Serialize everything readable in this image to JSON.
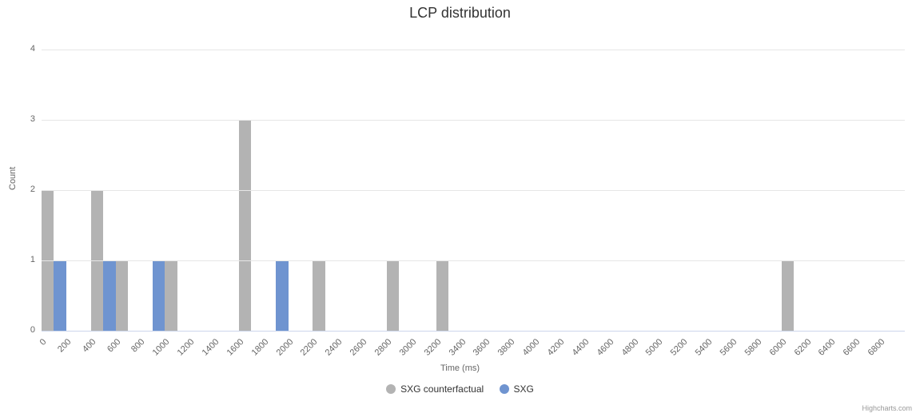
{
  "chart_data": {
    "type": "bar",
    "title": "LCP distribution",
    "xlabel": "Time (ms)",
    "ylabel": "Count",
    "ylim": [
      0,
      4
    ],
    "categories": [
      0,
      200,
      400,
      600,
      800,
      1000,
      1200,
      1400,
      1600,
      1800,
      2000,
      2200,
      2400,
      2600,
      2800,
      3000,
      3200,
      3400,
      3600,
      3800,
      4000,
      4200,
      4400,
      4600,
      4800,
      5000,
      5200,
      5400,
      5600,
      5800,
      6000,
      6200,
      6400,
      6600,
      6800
    ],
    "series": [
      {
        "name": "SXG counterfactual",
        "color": "#b3b3b3",
        "values": [
          2,
          0,
          2,
          1,
          0,
          1,
          0,
          0,
          3,
          0,
          0,
          1,
          0,
          0,
          1,
          0,
          1,
          0,
          0,
          0,
          0,
          0,
          0,
          0,
          0,
          0,
          0,
          0,
          0,
          0,
          1,
          0,
          0,
          0,
          0
        ]
      },
      {
        "name": "SXG",
        "color": "#6f94d0",
        "values": [
          1,
          0,
          1,
          0,
          1,
          0,
          0,
          0,
          0,
          1,
          0,
          0,
          0,
          0,
          0,
          0,
          0,
          0,
          0,
          0,
          0,
          0,
          0,
          0,
          0,
          0,
          0,
          0,
          0,
          0,
          0,
          0,
          0,
          0,
          0
        ]
      }
    ],
    "legend_position": "bottom",
    "grid": true
  },
  "credit": "Highcharts.com"
}
